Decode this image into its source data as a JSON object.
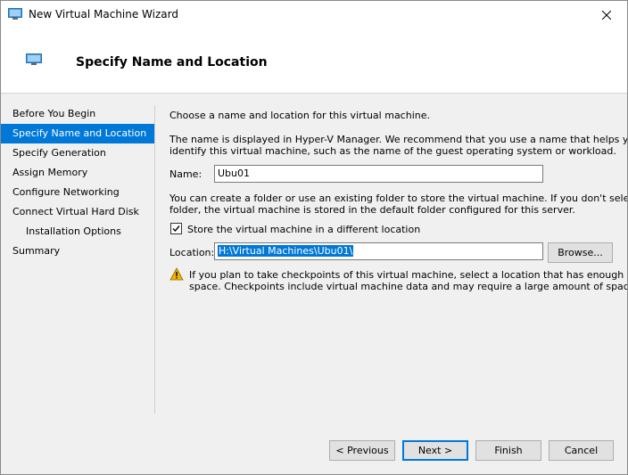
{
  "window": {
    "title": "New Virtual Machine Wizard"
  },
  "header": {
    "title": "Specify Name and Location"
  },
  "nav": {
    "items": [
      {
        "label": "Before You Begin",
        "active": false,
        "indent": false
      },
      {
        "label": "Specify Name and Location",
        "active": true,
        "indent": false
      },
      {
        "label": "Specify Generation",
        "active": false,
        "indent": false
      },
      {
        "label": "Assign Memory",
        "active": false,
        "indent": false
      },
      {
        "label": "Configure Networking",
        "active": false,
        "indent": false
      },
      {
        "label": "Connect Virtual Hard Disk",
        "active": false,
        "indent": false
      },
      {
        "label": "Installation Options",
        "active": false,
        "indent": true
      },
      {
        "label": "Summary",
        "active": false,
        "indent": false
      }
    ]
  },
  "content": {
    "intro": "Choose a name and location for this virtual machine.",
    "name_desc_line1": "The name is displayed in Hyper-V Manager. We recommend that you use a name that helps you easily",
    "name_desc_line2": "identify this virtual machine, such as the name of the guest operating system or workload.",
    "name_label": "Name:",
    "name_value": "Ubu01",
    "folder_desc_line1": "You can create a folder or use an existing folder to store the virtual machine. If you don't select a",
    "folder_desc_line2": "folder, the virtual machine is stored in the default folder configured for this server.",
    "store_checkbox_label": "Store the virtual machine in a different location",
    "store_checked": true,
    "location_label": "Location:",
    "location_value": "H:\\Virtual Machines\\Ubu01\\",
    "browse_label": "Browse...",
    "warning_line1": "If you plan to take checkpoints of this virtual machine, select a location that has enough free",
    "warning_line2": "space. Checkpoints include virtual machine data and may require a large amount of space."
  },
  "footer": {
    "previous_label": "< Previous",
    "next_label": "Next >",
    "finish_label": "Finish",
    "cancel_label": "Cancel"
  },
  "colors": {
    "accent": "#0078d7",
    "warning": "#f2b400"
  }
}
